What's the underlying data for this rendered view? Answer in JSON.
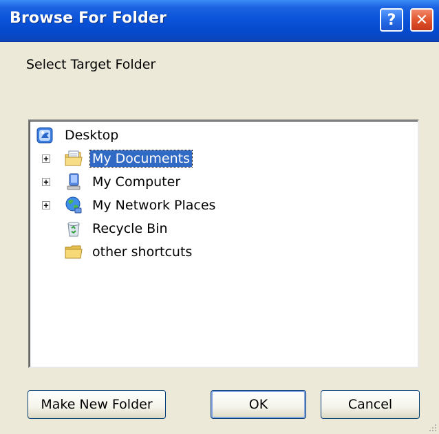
{
  "window": {
    "title": "Browse For Folder",
    "help_label": "?",
    "close_label": "✕"
  },
  "prompt": "Select Target Folder",
  "tree": {
    "items": [
      {
        "label": "Desktop",
        "icon": "desktop-icon",
        "expandable": false,
        "selected": false
      },
      {
        "label": "My Documents",
        "icon": "my-documents-icon",
        "expandable": true,
        "selected": true
      },
      {
        "label": "My Computer",
        "icon": "my-computer-icon",
        "expandable": true,
        "selected": false
      },
      {
        "label": "My Network Places",
        "icon": "network-places-icon",
        "expandable": true,
        "selected": false
      },
      {
        "label": "Recycle Bin",
        "icon": "recycle-bin-icon",
        "expandable": false,
        "selected": false
      },
      {
        "label": "other shortcuts",
        "icon": "folder-icon",
        "expandable": false,
        "selected": false
      }
    ],
    "expander_symbol": "+"
  },
  "buttons": {
    "make_new_folder": "Make New Folder",
    "ok": "OK",
    "cancel": "Cancel"
  },
  "colors": {
    "titlebar": "#0A52D8",
    "selection": "#316AC5",
    "dialog_bg": "#ECE9D8"
  }
}
